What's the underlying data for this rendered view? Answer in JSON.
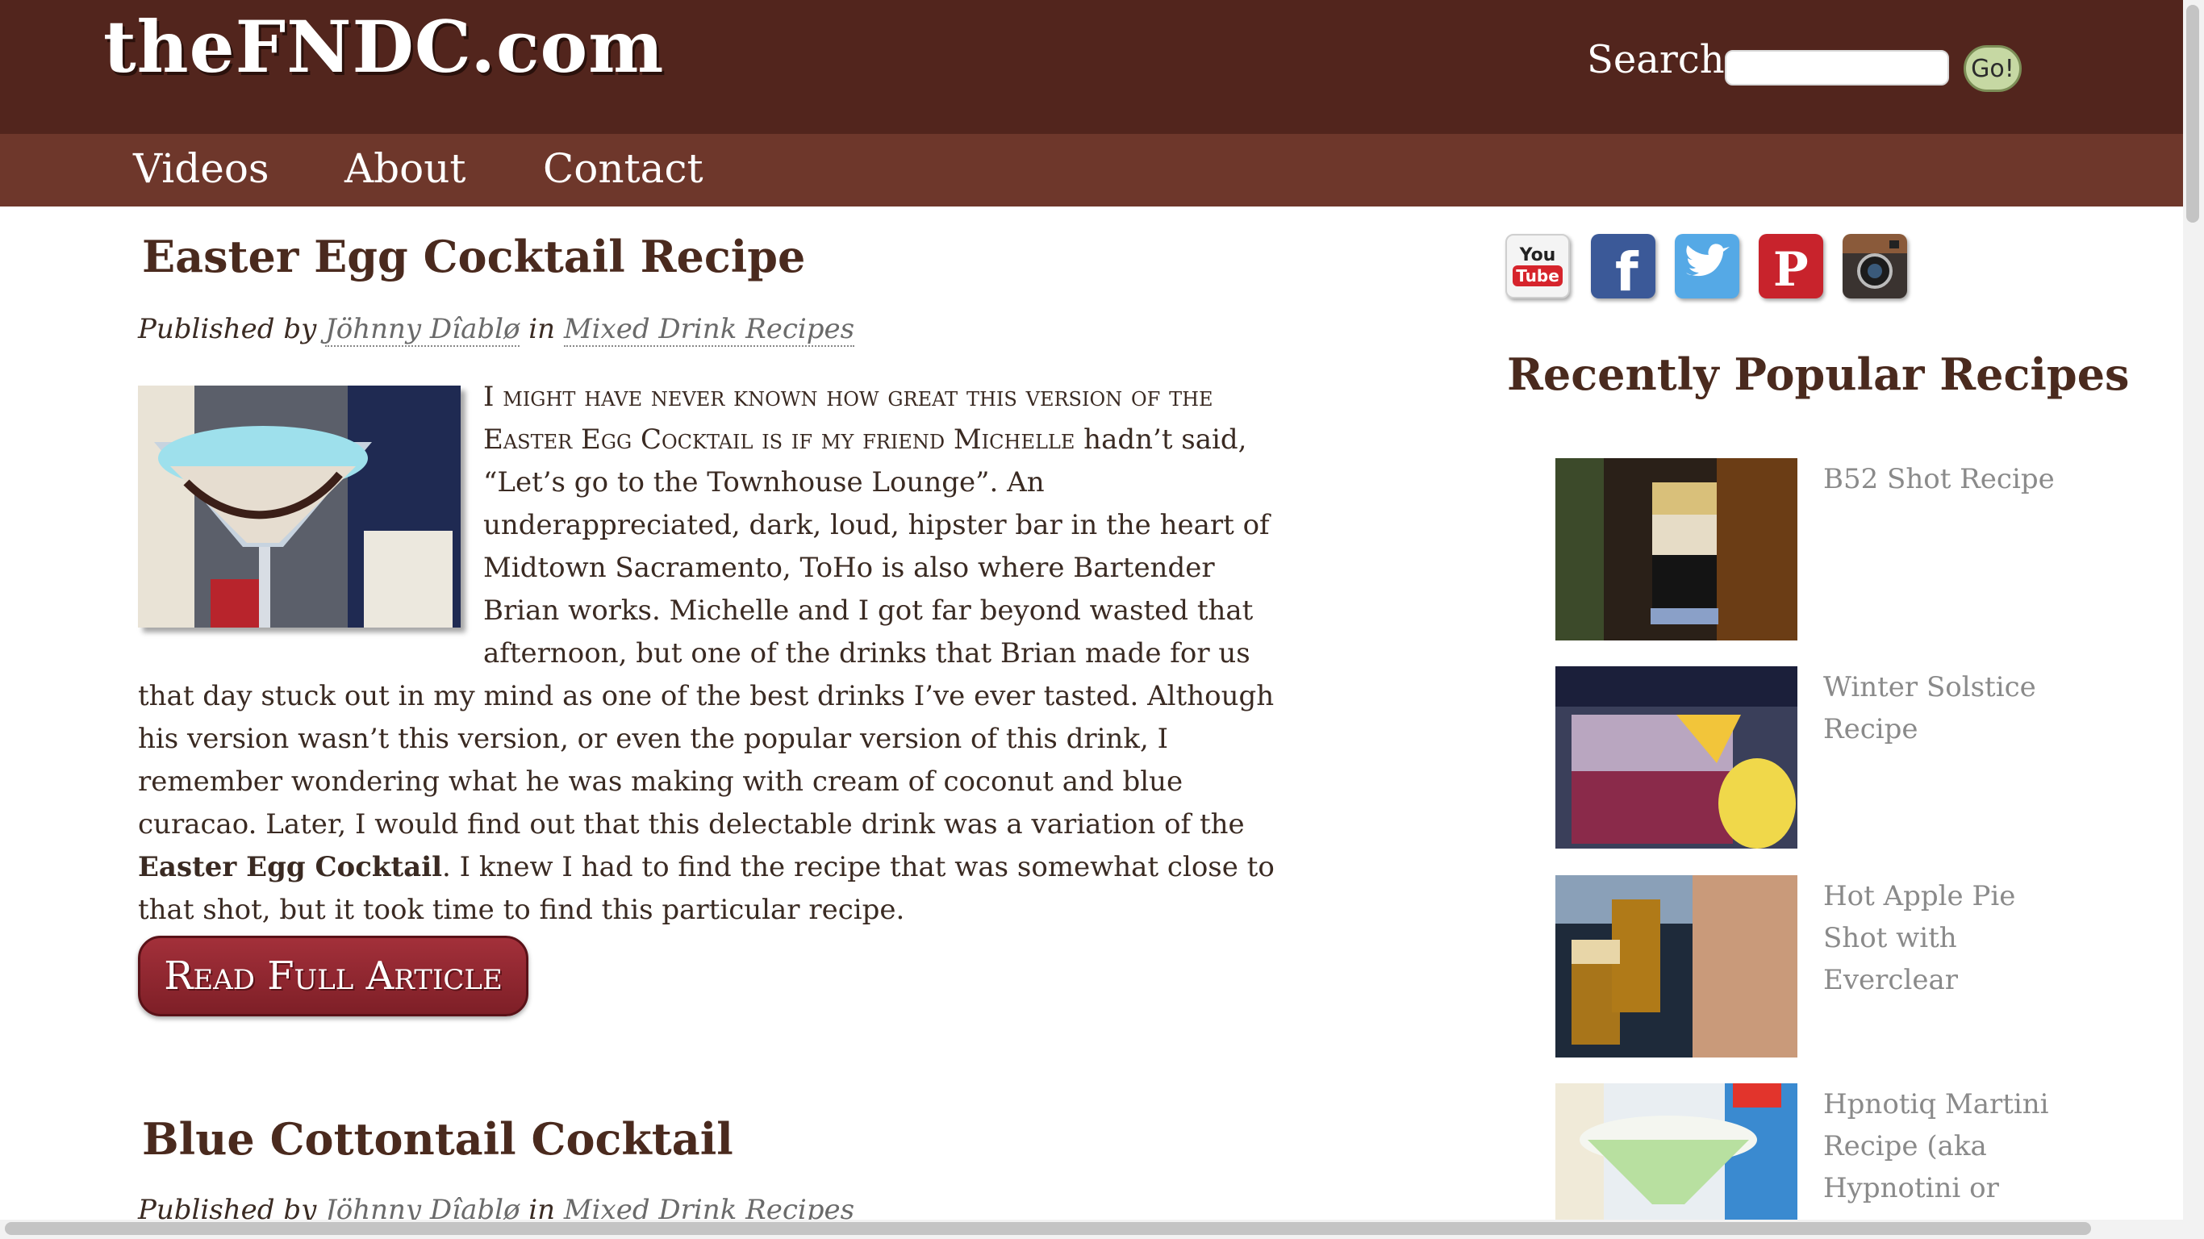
{
  "header": {
    "logo": "theFNDC.com",
    "search_label": "Search",
    "search_value": "",
    "search_button": "Go!"
  },
  "nav": {
    "items": [
      "Videos",
      "About",
      "Contact"
    ]
  },
  "posts": [
    {
      "title": "Easter Egg Cocktail Recipe",
      "published_by": "Published by",
      "author": "Jöhnny Dîablø",
      "in_label": "in",
      "category": "Mixed Drink Recipes",
      "body_smallcaps": "I might have never known how great this version of the Easter Egg Cocktail is if my friend Michelle",
      "body_part1": " hadn’t said, “Let’s go to the Townhouse Lounge”. An underappreciated, dark, loud, hipster bar in the heart of Midtown Sacramento, ToHo is also where Bartender Brian works. Michelle and I got far beyond wasted that afternoon, but one of the drinks that Brian made for us that day stuck out in my mind as one of the best drinks I’ve ever tasted. Although his version wasn’t this version, or even the popular version of this drink, I remember wondering what he was making with cream of coconut and blue curacao. Later, I would find out that this delectable drink was a variation of the ",
      "body_bold": "Easter Egg Cocktail",
      "body_part2": ". I knew I had to find the recipe that was somewhat close to that shot, but it took time to find this particular recipe.",
      "read_more": "Read Full Article"
    },
    {
      "title": "Blue Cottontail Cocktail",
      "published_by": "Published by",
      "author": "Jöhnny Dîablø",
      "in_label": "in",
      "category": "Mixed Drink Recipes"
    }
  ],
  "sidebar": {
    "social": [
      "youtube-icon",
      "facebook-icon",
      "twitter-icon",
      "pinterest-icon",
      "instagram-icon"
    ],
    "youtube_text": [
      "You",
      "Tube"
    ],
    "heading": "Recently Popular Recipes",
    "popular": [
      {
        "title": "B52 Shot Recipe"
      },
      {
        "title": "Winter Solstice Recipe"
      },
      {
        "title": "Hot Apple Pie Shot with Everclear"
      },
      {
        "title": "Hpnotiq Martini Recipe (aka Hypnotini or"
      }
    ]
  },
  "colors": {
    "header_bg": "#52251d",
    "nav_bg": "#6e372b",
    "title_text": "#4a2a1e",
    "button_bg": "#8e2530",
    "search_button_bg": "#c6d8a3"
  }
}
